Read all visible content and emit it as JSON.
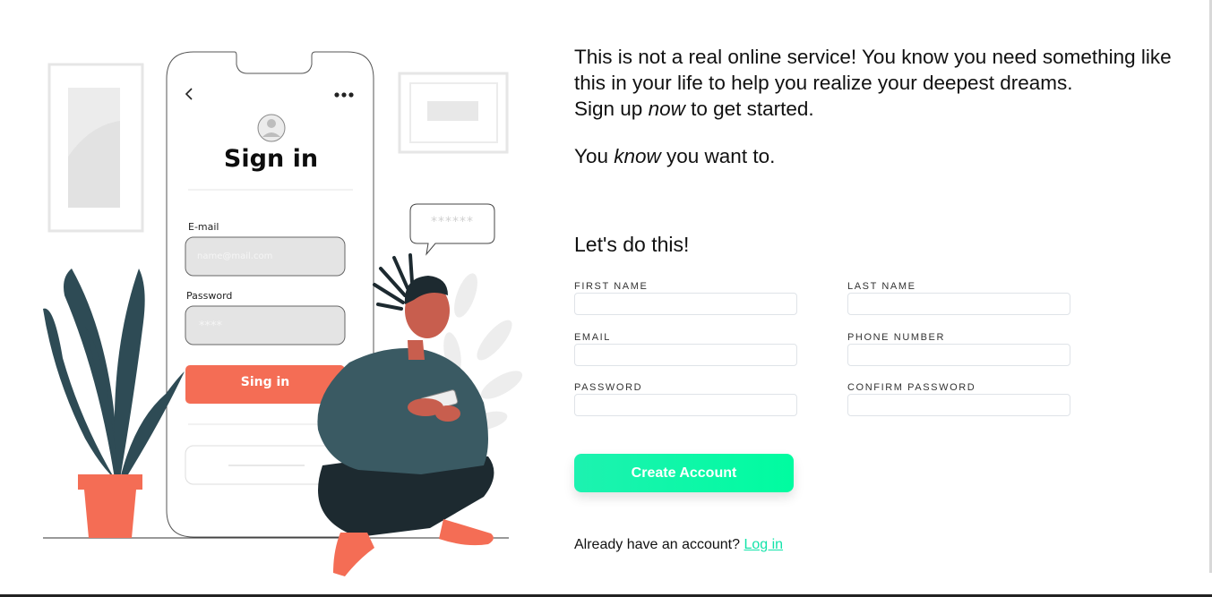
{
  "illustration": {
    "app": {
      "title": "Sign in",
      "email_label": "E-mail",
      "email_placeholder": "name@mail.com",
      "password_label": "Password",
      "password_placeholder": "****",
      "button_label": "Sing in",
      "bubble_text": "******"
    },
    "colors": {
      "accent": "#f46d55",
      "plant": "#2e4b55",
      "shirt": "#3a5a63",
      "pants": "#1d2a30"
    }
  },
  "intro": {
    "line1": "This is not a real online service! You know you need something like this in your life to help you realize your deepest dreams.",
    "line2_pre": "Sign up ",
    "line2_em": "now",
    "line2_post": " to get started.",
    "line3_pre": "You ",
    "line3_em": "know",
    "line3_post": " you want to."
  },
  "form": {
    "title": "Let's do this!",
    "fields": [
      {
        "label": "FIRST NAME",
        "value": ""
      },
      {
        "label": "LAST NAME",
        "value": ""
      },
      {
        "label": "EMAIL",
        "value": ""
      },
      {
        "label": "PHONE NUMBER",
        "value": ""
      },
      {
        "label": "PASSWORD",
        "value": ""
      },
      {
        "label": "CONFIRM PASSWORD",
        "value": ""
      }
    ],
    "submit_label": "Create Account",
    "accent_color": "#00f5a8",
    "login_prompt": "Already have an account?",
    "login_link": "Log in"
  }
}
